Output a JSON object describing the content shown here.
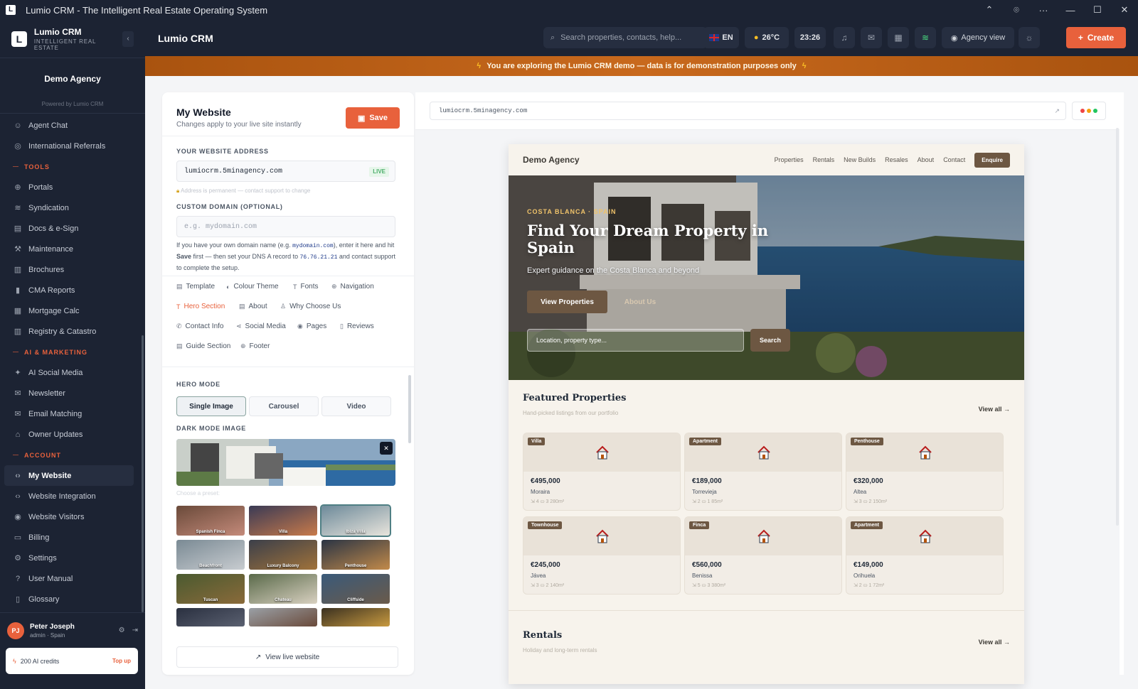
{
  "window": {
    "title": "Lumio CRM - The Intelligent Real Estate Operating System"
  },
  "brand": {
    "name": "Lumio CRM",
    "tagline": "INTELLIGENT REAL ESTATE",
    "logo_letter": "L"
  },
  "agency": {
    "name": "Demo Agency",
    "powered": "Powered by Lumio CRM"
  },
  "sidebar": {
    "items": [
      {
        "type": "item",
        "label": "Agent Chat",
        "icon": "agent-icon",
        "glyph": "☺"
      },
      {
        "type": "item",
        "label": "International Referrals",
        "icon": "referral-icon",
        "glyph": "◎"
      },
      {
        "type": "section",
        "label": "TOOLS"
      },
      {
        "type": "item",
        "label": "Portals",
        "icon": "globe-icon",
        "glyph": "⊕"
      },
      {
        "type": "item",
        "label": "Syndication",
        "icon": "broadcast-icon",
        "glyph": "≋"
      },
      {
        "type": "item",
        "label": "Docs & e-Sign",
        "icon": "document-icon",
        "glyph": "▤"
      },
      {
        "type": "item",
        "label": "Maintenance",
        "icon": "wrench-icon",
        "glyph": "⚒"
      },
      {
        "type": "item",
        "label": "Brochures",
        "icon": "book-icon",
        "glyph": "▥"
      },
      {
        "type": "item",
        "label": "CMA Reports",
        "icon": "bar-chart-icon",
        "glyph": "▮"
      },
      {
        "type": "item",
        "label": "Mortgage Calc",
        "icon": "calculator-icon",
        "glyph": "▦"
      },
      {
        "type": "item",
        "label": "Registry & Catastro",
        "icon": "registry-book-icon",
        "glyph": "▥"
      },
      {
        "type": "section",
        "label": "AI & MARKETING"
      },
      {
        "type": "item",
        "label": "AI Social Media",
        "icon": "sparkle-icon",
        "glyph": "✦"
      },
      {
        "type": "item",
        "label": "Newsletter",
        "icon": "mail-icon",
        "glyph": "✉"
      },
      {
        "type": "item",
        "label": "Email Matching",
        "icon": "mail-match-icon",
        "glyph": "✉"
      },
      {
        "type": "item",
        "label": "Owner Updates",
        "icon": "home-icon",
        "glyph": "⌂"
      },
      {
        "type": "section",
        "label": "ACCOUNT"
      },
      {
        "type": "item",
        "label": "My Website",
        "icon": "code-icon",
        "glyph": "‹›",
        "active": true
      },
      {
        "type": "item",
        "label": "Website Integration",
        "icon": "code-icon",
        "glyph": "‹›"
      },
      {
        "type": "item",
        "label": "Website Visitors",
        "icon": "eye-icon",
        "glyph": "◉"
      },
      {
        "type": "item",
        "label": "Billing",
        "icon": "credit-card-icon",
        "glyph": "▭"
      },
      {
        "type": "item",
        "label": "Settings",
        "icon": "gear-icon",
        "glyph": "⚙"
      },
      {
        "type": "item",
        "label": "User Manual",
        "icon": "help-icon",
        "glyph": "?"
      },
      {
        "type": "item",
        "label": "Glossary",
        "icon": "bookmark-icon",
        "glyph": "▯"
      }
    ],
    "user": {
      "initials": "PJ",
      "name": "Peter Joseph",
      "role": "admin · Spain"
    },
    "credits": {
      "label": "200 AI credits",
      "topup": "Top up"
    }
  },
  "topbar": {
    "title": "Lumio CRM",
    "search_placeholder": "Search properties, contacts, help...",
    "language": "EN",
    "weather": "26°C",
    "time": "23:26",
    "agency_view": "Agency view",
    "create": "Create"
  },
  "banner": {
    "text": "You are exploring the Lumio CRM demo — data is for demonstration purposes only"
  },
  "editor": {
    "title": "My Website",
    "subtitle": "Changes apply to your live site instantly",
    "save": "Save",
    "address_label": "YOUR WEBSITE ADDRESS",
    "address_value": "lumiocrm.5minagency.com",
    "live": "LIVE",
    "address_note": "Address is permanent — contact support to change",
    "custom_label": "CUSTOM DOMAIN (OPTIONAL)",
    "custom_placeholder": "e.g. mydomain.com",
    "help_1": "If you have your own domain name (e.g. ",
    "help_code1": "mydomain.com",
    "help_2": "), enter it here and hit ",
    "help_bold": "Save",
    "help_3": " first — then set your DNS A record to ",
    "help_code2": "76.76.21.21",
    "help_4": " and contact support to complete the setup.",
    "tabs": [
      {
        "label": "Template",
        "icon": "layout-icon",
        "glyph": "▤"
      },
      {
        "label": "Colour Theme",
        "icon": "palette-icon",
        "glyph": "◐"
      },
      {
        "label": "Fonts",
        "icon": "type-icon",
        "glyph": "T"
      },
      {
        "label": "Navigation",
        "icon": "globe-icon",
        "glyph": "⊕"
      },
      {
        "label": "Hero Section",
        "icon": "type-icon",
        "glyph": "T",
        "active": true
      },
      {
        "label": "About",
        "icon": "layout-icon",
        "glyph": "▤"
      },
      {
        "label": "Why Choose Us",
        "icon": "award-icon",
        "glyph": "♙"
      },
      {
        "label": "Contact Info",
        "icon": "phone-icon",
        "glyph": "✆"
      },
      {
        "label": "Social Media",
        "icon": "share-icon",
        "glyph": "⋖"
      },
      {
        "label": "Pages",
        "icon": "eye-icon",
        "glyph": "◉"
      },
      {
        "label": "Reviews",
        "icon": "square-icon",
        "glyph": "▯"
      },
      {
        "label": "Guide Section",
        "icon": "document-icon",
        "glyph": "▤"
      },
      {
        "label": "Footer",
        "icon": "globe-icon",
        "glyph": "⊕"
      }
    ],
    "hero_mode_label": "HERO MODE",
    "modes": [
      "Single Image",
      "Carousel",
      "Video"
    ],
    "dark_image_label": "DARK MODE IMAGE",
    "preset_hint": "Choose a preset:",
    "presets": [
      "Spanish Finca",
      "Villa",
      "Ibiza Villa",
      "Beachfront",
      "Luxury Balcony",
      "Penthouse",
      "Tuscan",
      "Chateau",
      "Cliffside",
      "",
      "",
      ""
    ],
    "view_live": "View live website"
  },
  "preview": {
    "url": "lumiocrm.5minagency.com",
    "site": {
      "logo": "Demo Agency",
      "nav": [
        "Properties",
        "Rentals",
        "New Builds",
        "Resales",
        "About",
        "Contact"
      ],
      "enquire": "Enquire",
      "kicker": "COSTA BLANCA · SPAIN",
      "headline": "Find Your Dream Property in Spain",
      "subline": "Expert guidance on the Costa Blanca and beyond",
      "btn_primary": "View Properties",
      "btn_secondary": "About Us",
      "search_placeholder": "Location, property type...",
      "search_btn": "Search",
      "featured_title": "Featured Properties",
      "featured_sub": "Hand-picked listings from our portfolio",
      "view_all": "View all →",
      "properties": [
        {
          "type": "Villa",
          "price": "€495,000",
          "location": "Moraira",
          "meta": "⇲ 4  ⛀ 3  280m²"
        },
        {
          "type": "Apartment",
          "price": "€189,000",
          "location": "Torrevieja",
          "meta": "⇲ 2  ⛀ 1  85m²"
        },
        {
          "type": "Penthouse",
          "price": "€320,000",
          "location": "Altea",
          "meta": "⇲ 3  ⛀ 2  150m²"
        },
        {
          "type": "Townhouse",
          "price": "€245,000",
          "location": "Jávea",
          "meta": "⇲ 3  ⛀ 2  140m²"
        },
        {
          "type": "Finca",
          "price": "€560,000",
          "location": "Benissa",
          "meta": "⇲ 5  ⛀ 3  380m²"
        },
        {
          "type": "Apartment",
          "price": "€149,000",
          "location": "Orihuela",
          "meta": "⇲ 2  ⛀ 1  72m²"
        }
      ],
      "rentals_title": "Rentals",
      "rentals_sub": "Holiday and long-term rentals"
    }
  },
  "colors": {
    "accent": "#e8613c",
    "sidebar": "#1c2333",
    "site_brown": "#6d5742",
    "banner": "#b85f16"
  }
}
